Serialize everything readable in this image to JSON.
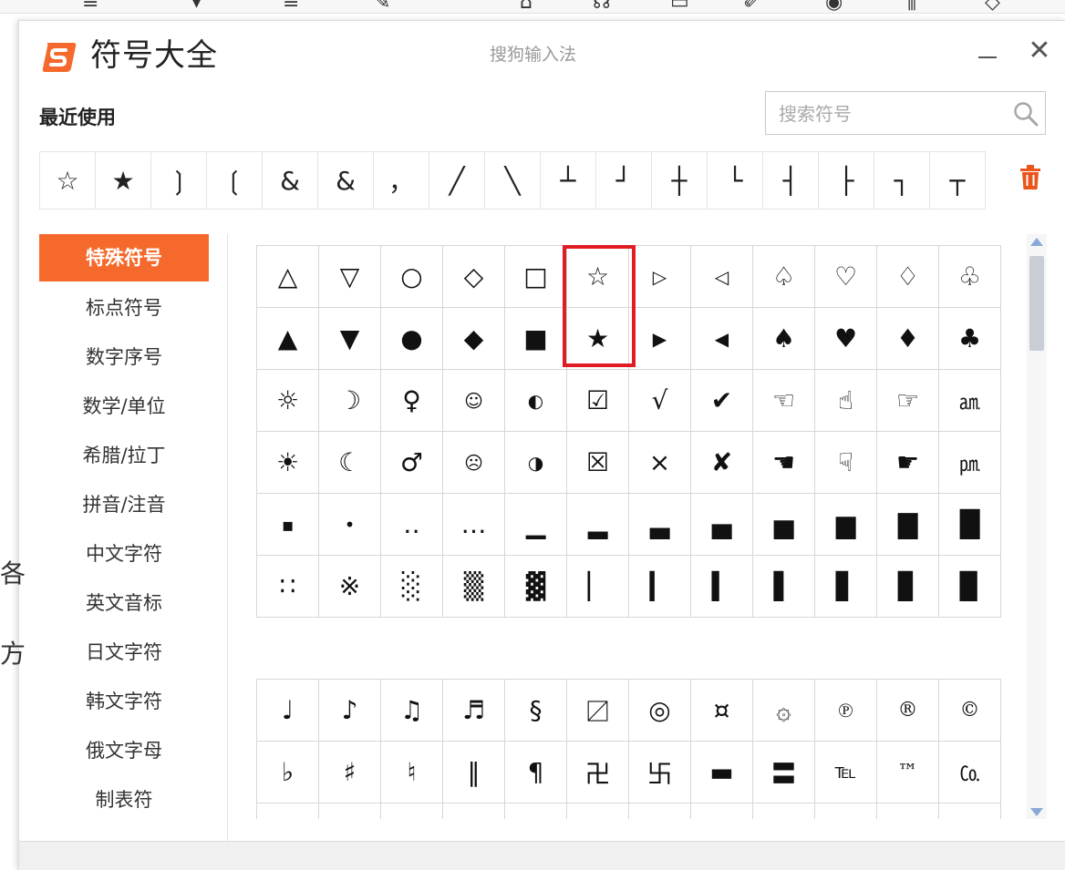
{
  "background": {
    "toolbar_glyphs": [
      "≡",
      "▾",
      "≡",
      "✎",
      "⌂",
      "☊",
      "▭",
      "✐",
      "◉",
      "⫼",
      "◇"
    ],
    "side_glyphs": [
      "各",
      "方"
    ]
  },
  "window": {
    "title": "符号大全",
    "brand": "搜狗输入法",
    "minimize_label": "",
    "close_label": "✕"
  },
  "recent": {
    "heading": "最近使用",
    "search_placeholder": "搜索符号",
    "symbols": [
      "☆",
      "★",
      "❳",
      "❲",
      "&",
      "&",
      "，",
      "╱",
      "╲",
      "┴",
      "┘",
      "┼",
      "└",
      "┤",
      "├",
      "┐",
      "┬"
    ]
  },
  "categories": [
    {
      "label": "特殊符号",
      "active": true
    },
    {
      "label": "标点符号",
      "active": false
    },
    {
      "label": "数字序号",
      "active": false
    },
    {
      "label": "数学/单位",
      "active": false
    },
    {
      "label": "希腊/拉丁",
      "active": false
    },
    {
      "label": "拼音/注音",
      "active": false
    },
    {
      "label": "中文字符",
      "active": false
    },
    {
      "label": "英文音标",
      "active": false
    },
    {
      "label": "日文字符",
      "active": false
    },
    {
      "label": "韩文字符",
      "active": false
    },
    {
      "label": "俄文字母",
      "active": false
    },
    {
      "label": "制表符",
      "active": false
    }
  ],
  "grid_1": [
    [
      "△",
      "▽",
      "○",
      "◇",
      "□",
      "☆",
      "▷",
      "◁",
      "♤",
      "♡",
      "♢",
      "♧"
    ],
    [
      "▲",
      "▼",
      "●",
      "◆",
      "■",
      "★",
      "▶",
      "◀",
      "♠",
      "♥",
      "♦",
      "♣"
    ],
    [
      "☼",
      "☽",
      "♀",
      "☺",
      "◐",
      "☑",
      "√",
      "✔",
      "☜",
      "☝",
      "☞",
      "㏂"
    ],
    [
      "☀",
      "☾",
      "♂",
      "☹",
      "◑",
      "☒",
      "×",
      "✘",
      "☚",
      "☟",
      "☛",
      "㏘"
    ],
    [
      "▪",
      "•",
      "‥",
      "…",
      "▁",
      "▂",
      "▃",
      "▄",
      "▅",
      "▆",
      "▇",
      "█"
    ],
    [
      "∷",
      "※",
      "░",
      "▒",
      "▓",
      "▏",
      "▎",
      "▍",
      "▌",
      "▋",
      "▊",
      "▉"
    ]
  ],
  "grid_2": [
    [
      "♩",
      "♪",
      "♫",
      "♬",
      "§",
      "〼",
      "◎",
      "¤",
      "۞",
      "℗",
      "®",
      "©"
    ],
    [
      "♭",
      "♯",
      "♮",
      "‖",
      "¶",
      "卍",
      "卐",
      "▬",
      "〓",
      "℡",
      "™",
      "㏇"
    ],
    [
      "",
      "",
      "",
      "",
      "",
      "",
      "",
      "",
      "",
      "",
      "",
      ""
    ]
  ],
  "colors": {
    "accent": "#f56a2c",
    "highlight": "#e01c24",
    "scroll_arrow": "#8aa9d6"
  }
}
